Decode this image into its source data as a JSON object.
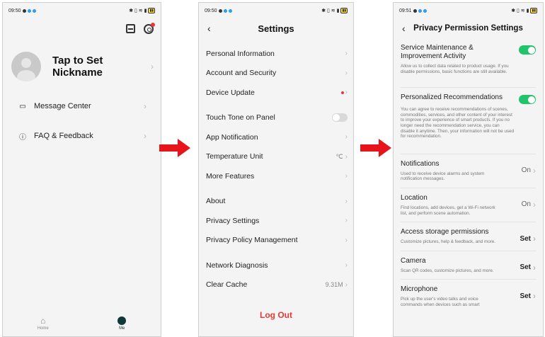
{
  "phone1": {
    "status_time": "09:50",
    "nickname": "Tap to Set Nickname",
    "items": [
      {
        "icon": "message-icon",
        "label": "Message Center"
      },
      {
        "icon": "question-icon",
        "label": "FAQ & Feedback"
      }
    ],
    "tabs": [
      {
        "icon": "home-icon",
        "label": "Home"
      },
      {
        "icon": "me-icon",
        "label": "Me"
      }
    ]
  },
  "phone2": {
    "status_time": "09:50",
    "title": "Settings",
    "groups": [
      [
        "Personal Information",
        "Account and Security",
        "Device Update"
      ],
      [
        "Touch Tone on Panel",
        "App Notification",
        "Temperature Unit",
        "More Features"
      ],
      [
        "About",
        "Privacy Settings",
        "Privacy Policy Management"
      ],
      [
        "Network Diagnosis",
        "Clear Cache"
      ]
    ],
    "temperature_value": "℃",
    "cache_value": "9.31M",
    "logout": "Log Out"
  },
  "phone3": {
    "status_time": "09:51",
    "title": "Privacy Permission Settings",
    "toggles": [
      {
        "title": "Service Maintenance & Improvement Activity",
        "desc": "Allow us to collect data related to product usage. If you disable permissions, basic functions are still available."
      },
      {
        "title": "Personalized Recommendations",
        "desc": "You can agree to receive recommendations of scenes, commodities, services, and other content of your interest to improve your experience of smart products. If you no longer need the recommendation service, you can disable it anytime. Then, your information will not be used for recommendation."
      }
    ],
    "permissions": [
      {
        "title": "Notifications",
        "desc": "Used to receive device alarms and system notification messages.",
        "value": "On"
      },
      {
        "title": "Location",
        "desc": "Find locations, add devices, get a Wi-Fi network list, and perform scene automation.",
        "value": "On"
      },
      {
        "title": "Access storage permissions",
        "desc": "Customize pictures, help & feedback, and more.",
        "value": "Set"
      },
      {
        "title": "Camera",
        "desc": "Scan QR codes, customize pictures, and more.",
        "value": "Set"
      },
      {
        "title": "Microphone",
        "desc": "Pick up the user's video talks and voice commands when devices such as smart",
        "value": "Set"
      }
    ]
  },
  "colors": {
    "accent_red": "#e8141b",
    "toggle_green": "#21c46a",
    "logout_red": "#e53935"
  }
}
